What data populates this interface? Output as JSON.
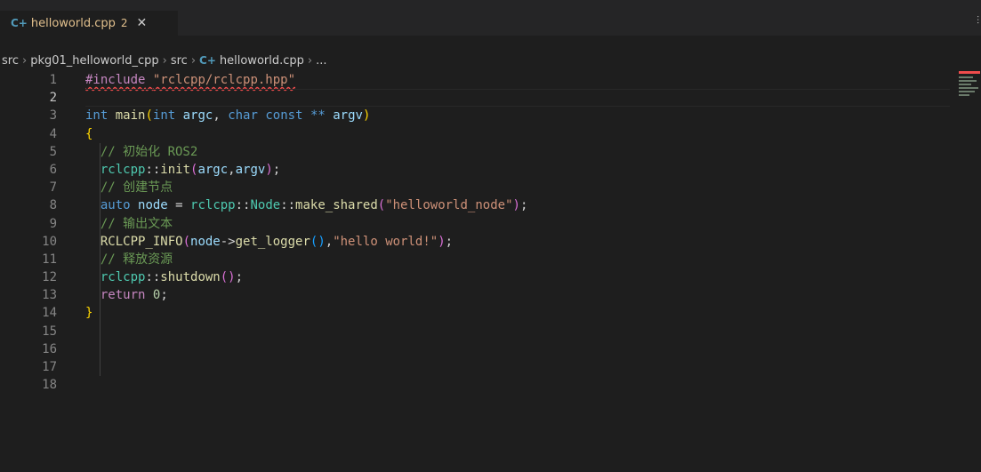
{
  "tab": {
    "icon": "C+",
    "filename": "helloworld.cpp",
    "problems_badge": "2",
    "close_glyph": "✕"
  },
  "breadcrumb": {
    "parts": [
      "src",
      "pkg01_helloworld_cpp",
      "src"
    ],
    "file_icon": "C+",
    "file": "helloworld.cpp",
    "ellipsis": "..."
  },
  "editor": {
    "line_numbers": [
      "1",
      "2",
      "3",
      "4",
      "5",
      "6",
      "7",
      "8",
      "9",
      "10",
      "11",
      "12",
      "13",
      "14",
      "15",
      "16",
      "17",
      "18"
    ],
    "active_line": "2",
    "lines": {
      "l1": {
        "directive": "#include",
        "path": "\"rclcpp/rclcpp.hpp\""
      },
      "l3": {
        "type1": "int",
        "name": "main",
        "open": "(",
        "type2": "int",
        "arg1": "argc",
        "comma": ", ",
        "type3": "char",
        "kw_const": "const",
        "stars": "**",
        "arg2": "argv",
        "close": ")"
      },
      "l4": {
        "brace": "{"
      },
      "l5": {
        "comment": "// 初始化 ROS2"
      },
      "l6": {
        "ns": "rclcpp",
        "sep": "::",
        "fn": "init",
        "open": "(",
        "a1": "argc",
        "comma": ",",
        "a2": "argv",
        "close": ")",
        "semi": ";"
      },
      "l7": {
        "comment": "// 创建节点"
      },
      "l8": {
        "kw": "auto",
        "var": "node",
        "eq": " = ",
        "ns": "rclcpp",
        "sep1": "::",
        "cls": "Node",
        "sep2": "::",
        "fn": "make_shared",
        "open": "(",
        "str": "\"helloworld_node\"",
        "close": ")",
        "semi": ";"
      },
      "l9": {
        "comment": "// 输出文本"
      },
      "l10": {
        "macro": "RCLCPP_INFO",
        "open": "(",
        "var": "node",
        "arrow": "->",
        "fn": "get_logger",
        "call": "()",
        "comma": ",",
        "str": "\"hello world!\"",
        "close": ")",
        "semi": ";"
      },
      "l11": {
        "comment": "// 释放资源"
      },
      "l12": {
        "ns": "rclcpp",
        "sep": "::",
        "fn": "shutdown",
        "call": "()",
        "semi": ";"
      },
      "l13": {
        "kw": "return",
        "num": "0",
        "semi": ";"
      },
      "l14": {
        "brace": "}"
      }
    }
  },
  "colors": {
    "background": "#1e1e1e",
    "tab_modified": "#e2c08d",
    "error": "#f14c4c"
  }
}
